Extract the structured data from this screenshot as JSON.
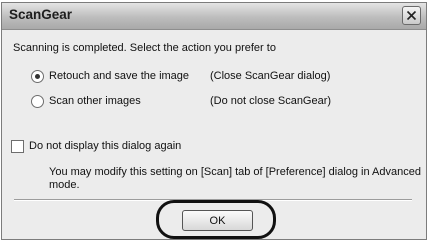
{
  "window": {
    "title": "ScanGear",
    "close_icon": "close-icon"
  },
  "prompt": "Scanning is completed. Select the action you prefer to",
  "options": [
    {
      "label": "Retouch and save the image",
      "note": "(Close ScanGear dialog)",
      "selected": true
    },
    {
      "label": "Scan other images",
      "note": "(Do not close ScanGear)",
      "selected": false
    }
  ],
  "checkbox": {
    "label": "Do not display this dialog again",
    "checked": false
  },
  "hint": {
    "line1": "You may modify this setting on [Scan] tab of  [Preference] dialog in Advanced",
    "line2": "mode."
  },
  "buttons": {
    "ok": "OK"
  }
}
